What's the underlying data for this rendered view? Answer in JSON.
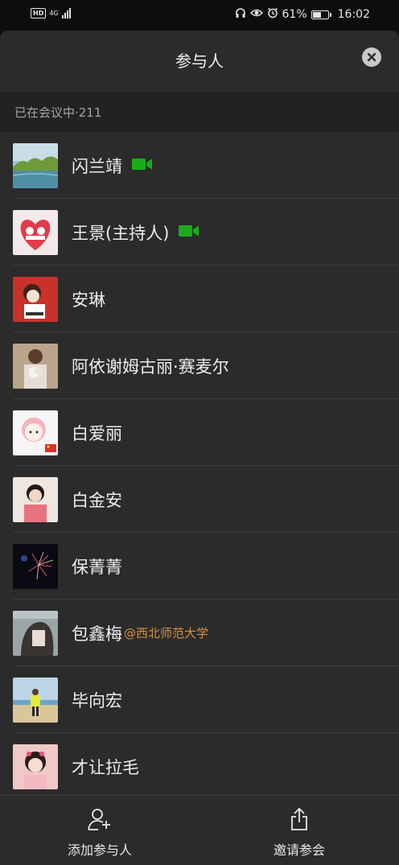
{
  "status_bar": {
    "hd": "HD",
    "network": "4G",
    "battery_percent": "61%",
    "battery_level": 0.61,
    "time": "16:02"
  },
  "sheet": {
    "title": "参与人",
    "close_icon": "close-icon"
  },
  "section": {
    "label": "已在会议中·211"
  },
  "participants": [
    {
      "name": "闪兰靖",
      "video": true,
      "org": ""
    },
    {
      "name": "王景(主持人)",
      "video": true,
      "org": ""
    },
    {
      "name": "安琳",
      "video": false,
      "org": ""
    },
    {
      "name": "阿依谢姆古丽·赛麦尔",
      "video": false,
      "org": ""
    },
    {
      "name": "白爱丽",
      "video": false,
      "org": ""
    },
    {
      "name": "白金安",
      "video": false,
      "org": ""
    },
    {
      "name": "保菁菁",
      "video": false,
      "org": ""
    },
    {
      "name": "包鑫梅",
      "video": false,
      "org": "@西北师范大学"
    },
    {
      "name": "毕向宏",
      "video": false,
      "org": ""
    },
    {
      "name": "才让拉毛",
      "video": false,
      "org": ""
    }
  ],
  "bottom_bar": {
    "add_label": "添加参与人",
    "invite_label": "邀请参会"
  },
  "colors": {
    "video_green": "#1aad19",
    "org_orange": "#d9903a",
    "sheet_bg": "#2b2b2b"
  }
}
